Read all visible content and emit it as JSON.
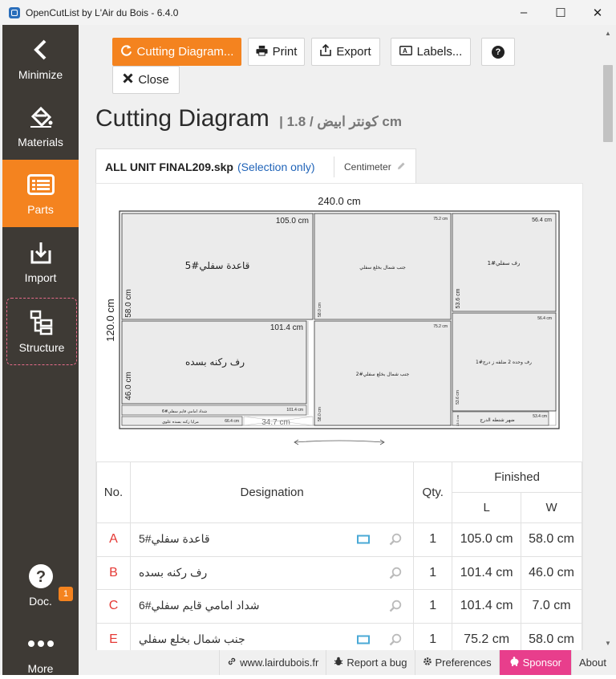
{
  "window": {
    "title": "OpenCutList by L'Air du Bois - 6.4.0",
    "controls": [
      "–",
      "☐",
      "✕"
    ]
  },
  "sidebar": {
    "items": [
      {
        "label": "Minimize",
        "icon": "chevron-left-icon"
      },
      {
        "label": "Materials",
        "icon": "paint-bucket-icon"
      },
      {
        "label": "Parts",
        "icon": "list-icon"
      },
      {
        "label": "Import",
        "icon": "import-icon"
      },
      {
        "label": "Structure",
        "icon": "hierarchy-icon"
      },
      {
        "label": "Doc.",
        "icon": "question-icon"
      },
      {
        "label": "More",
        "icon": "ellipsis-icon",
        "badge": "1"
      }
    ]
  },
  "toolbar": {
    "cutting_label": "Cutting Diagram...",
    "print_label": "Print",
    "export_label": "Export",
    "labels_label": "Labels...",
    "help_label": "?",
    "close_label": "Close"
  },
  "header": {
    "title": "Cutting Diagram",
    "subtitle": "| 1.8 / كونتر ابيض cm"
  },
  "tab": {
    "filename": "ALL UNIT FINAL209.skp",
    "selection": "(Selection only)",
    "unit": "Centimeter"
  },
  "diagram": {
    "width_label": "240.0 cm",
    "height_label": "120.0 cm",
    "trim_label": "34.7 cm",
    "parts": [
      {
        "name": "قاعدة سفلي#5",
        "len": "105.0 cm",
        "wid": "58.0 cm"
      },
      {
        "name": "رف ركنه بسده",
        "len": "101.4 cm",
        "wid": "46.0 cm"
      },
      {
        "name": "شداد امامي قايم سفلي#6",
        "len": "101.4 cm",
        "wid": ""
      },
      {
        "name": "مرايا ركنه بسده علوي",
        "len": "66.4 cm",
        "wid": ""
      },
      {
        "name": "جنب شمال بخلع سفلي",
        "len": "75.2 cm",
        "wid": "58.0 cm"
      },
      {
        "name": "جنب شمال بخلع سفلي#2",
        "len": "75.2 cm",
        "wid": "58.0 cm"
      },
      {
        "name": "رف سفلي#1",
        "len": "56.4 cm",
        "wid": "53.6 cm"
      },
      {
        "name": "رف وحده 2 ضلفه ز درج#1",
        "len": "56.4 cm",
        "wid": "53.6 cm"
      },
      {
        "name": "ضهر شنطه الدرج",
        "len": "53.4 cm",
        "wid": "13.0 cm"
      }
    ]
  },
  "table": {
    "headers": {
      "no": "No.",
      "designation": "Designation",
      "qty": "Qty.",
      "finished": "Finished",
      "l": "L",
      "w": "W"
    },
    "rows": [
      {
        "no": "A",
        "name": "قاعدة سفلي#5",
        "qty": "1",
        "l": "105.0 cm",
        "w": "58.0 cm",
        "flag": true,
        "flag_color": "#4aa9d6"
      },
      {
        "no": "B",
        "name": "رف ركنه بسده",
        "qty": "1",
        "l": "101.4 cm",
        "w": "46.0 cm",
        "flag": false
      },
      {
        "no": "C",
        "name": "شداد امامي قايم سفلي#6",
        "qty": "1",
        "l": "101.4 cm",
        "w": "7.0 cm",
        "flag": false
      },
      {
        "no": "E",
        "name": "جنب شمال بخلع سفلي",
        "qty": "1",
        "l": "75.2 cm",
        "w": "58.0 cm",
        "flag": true,
        "flag_color": "#4aa9d6"
      }
    ]
  },
  "footer": {
    "site": "www.lairdubois.fr",
    "report": "Report a bug",
    "prefs": "Preferences",
    "sponsor": "Sponsor",
    "about": "About"
  },
  "colors": {
    "accent": "#f4831f",
    "sidebar": "#3e3a35",
    "sponsor": "#e83e8c",
    "link": "#1f63b8",
    "letter": "#e53935"
  }
}
